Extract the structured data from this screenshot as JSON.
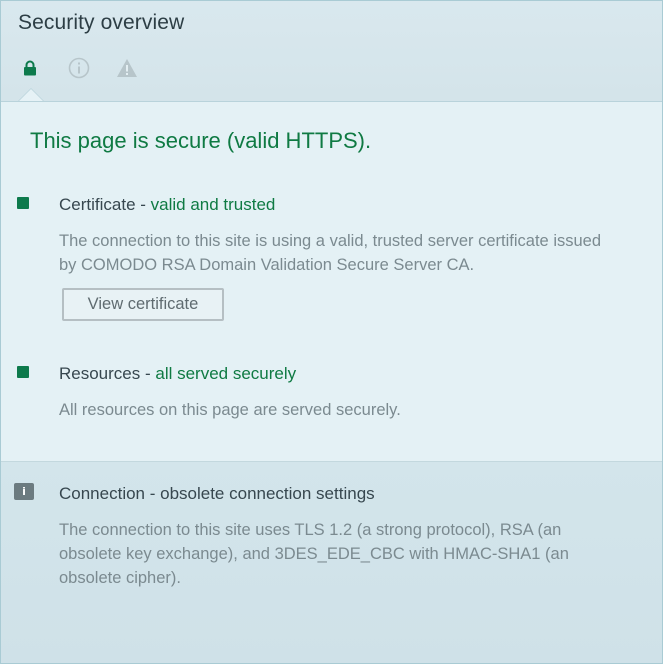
{
  "header": {
    "title": "Security overview",
    "tabs": [
      {
        "icon": "lock-icon",
        "active": true
      },
      {
        "icon": "info-icon",
        "active": false
      },
      {
        "icon": "warning-icon",
        "active": false
      }
    ]
  },
  "secure_panel": {
    "summary": "This page is secure (valid HTTPS).",
    "certificate": {
      "label": "Certificate - ",
      "status": "valid and trusted",
      "description_line1": "The connection to this site is using a valid, trusted server certificate issued",
      "description_line2": "by COMODO RSA Domain Validation Secure Server CA.",
      "button_label": "View certificate"
    },
    "resources": {
      "label": "Resources - ",
      "status": "all served securely",
      "description": "All resources on this page are served securely."
    }
  },
  "connection": {
    "badge": "i",
    "title": "Connection - obsolete connection settings",
    "description_line1": "The connection to this site uses TLS 1.2 (a strong protocol), RSA (an",
    "description_line2": "obsolete key exchange), and 3DES_EDE_CBC with HMAC-SHA1 (an",
    "description_line3": "obsolete cipher)."
  },
  "colors": {
    "secure_green": "#0f7a43",
    "bullet_green": "#0d7a4c",
    "muted_text": "#7b8a90",
    "icon_grey": "#b7c5ca"
  }
}
